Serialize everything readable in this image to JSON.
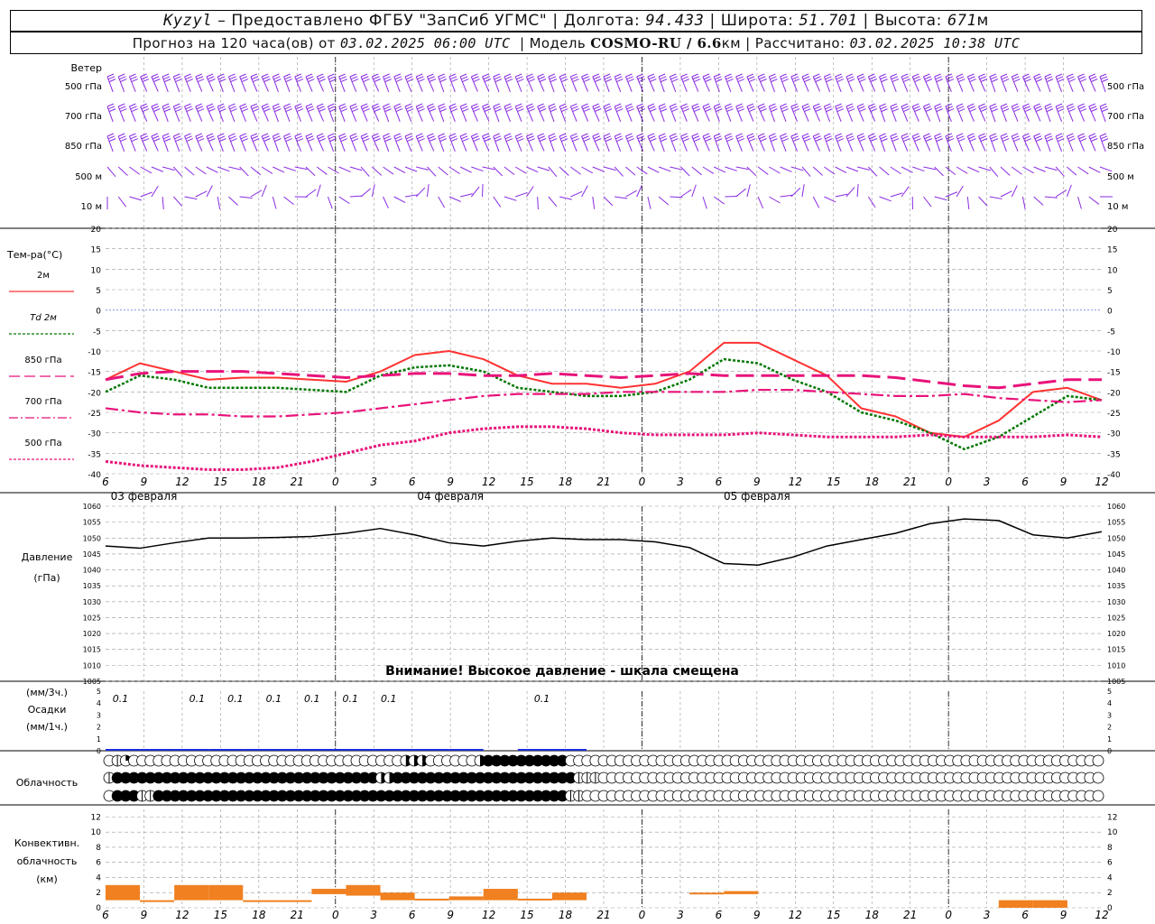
{
  "header": {
    "station": "Kyzyl",
    "provided_by": "– Предоставлено ФГБУ \"ЗапСиб УГМС\"",
    "lon_label": "Долгота:",
    "lon": "94.433",
    "lat_label": "Широта:",
    "lat": "51.701",
    "alt_label": "Высота:",
    "alt": "671",
    "alt_unit": "м",
    "forecast_label": "Прогноз на 120 часа(ов) от",
    "forecast_start": "03.02.2025 06:00 UTC",
    "model_label": "Модель",
    "model": "COSMO-RU / 6.6",
    "model_unit": "км",
    "computed_label": "Рассчитано:",
    "computed_at": "03.02.2025 10:38 UTC",
    "sep": "|"
  },
  "colors": {
    "t2m": "#ff3333",
    "td2m": "#007700",
    "t850": "#e8137a",
    "t700": "#e8137a",
    "t500": "#e8137a",
    "pressure": "#000000",
    "precip": "#1a2bdb",
    "convective": "#f08020",
    "wind": "#8a2be2",
    "zero_line": "#3a5ad8",
    "grid": "#999999"
  },
  "wind_panel": {
    "title": "Ветер",
    "levels": [
      "500 гПа",
      "700 гПа",
      "850 гПа",
      "500 м",
      "10  м"
    ]
  },
  "time_axis": {
    "hour_labels": [
      "6",
      "9",
      "12",
      "15",
      "18",
      "21",
      "0",
      "3",
      "6",
      "9",
      "12",
      "15",
      "18",
      "21",
      "0",
      "3",
      "6",
      "9",
      "12",
      "15",
      "18",
      "21",
      "0",
      "3",
      "6",
      "9",
      "12"
    ],
    "day_labels": [
      {
        "label": "03 февраля",
        "at_hour": 3
      },
      {
        "label": "04 февраля",
        "at_hour": 27
      },
      {
        "label": "05 февраля",
        "at_hour": 51
      }
    ],
    "day_starts_hours": [
      18,
      42,
      66,
      90
    ]
  },
  "temp_panel": {
    "title": "Тем-ра(°C)",
    "legend": [
      {
        "label": "2м",
        "key": "t2m"
      },
      {
        "label": "Td  2м",
        "key": "td2m"
      },
      {
        "label": "850 гПа",
        "key": "t850"
      },
      {
        "label": "700 гПа",
        "key": "t700"
      },
      {
        "label": "500 гПа",
        "key": "t500"
      }
    ],
    "y_ticks": [
      "20",
      "15",
      "10",
      "5",
      "0",
      "-5",
      "-10",
      "-15",
      "-20",
      "-25",
      "-30",
      "-35",
      "-40"
    ]
  },
  "pressure_panel": {
    "title": "Давление",
    "unit": "(гПа)",
    "y_ticks": [
      "1060",
      "1055",
      "1050",
      "1045",
      "1040",
      "1035",
      "1030",
      "1025",
      "1020",
      "1015",
      "1010",
      "1005"
    ],
    "warning": "Внимание! Высокое давление - шкала смещена"
  },
  "precip_panel": {
    "unit_top": "(мм/3ч.)",
    "title": "Осадки",
    "unit_bottom": "(мм/1ч.)",
    "y_ticks": [
      "5",
      "4",
      "3",
      "2",
      "1",
      "0"
    ],
    "labels": [
      {
        "text": "0.1",
        "hour": 0.6
      },
      {
        "text": "0.1",
        "hour": 6.6
      },
      {
        "text": "0.1",
        "hour": 9.6
      },
      {
        "text": "0.1",
        "hour": 12.6
      },
      {
        "text": "0.1",
        "hour": 15.6
      },
      {
        "text": "0.1",
        "hour": 18.6
      },
      {
        "text": "0.1",
        "hour": 21.6
      },
      {
        "text": "0.1",
        "hour": 33.6
      }
    ]
  },
  "cloud_panel": {
    "title": "Облачность",
    "rows": [
      "0120000000000000000000000000000000003330000003444444444400000000000000000000000000000000000000000000000000000000000000000",
      "1444444444444444444444444444444443344444444444444444444441110000000000000000000000000000000000000000000000000000000000000",
      "0444114444444444444444444444444444444444444444444444444411000000000000000000000000000000000000000000000000000000000000000"
    ]
  },
  "convective_panel": {
    "title_1": "Конвективн.",
    "title_2": "облачность",
    "unit": "(км)",
    "y_ticks": [
      "12",
      "10",
      "8",
      "6",
      "4",
      "2",
      "0"
    ]
  },
  "chart_data": [
    {
      "type": "line",
      "title": "Тем-ра(°C)",
      "x": [
        0,
        3,
        6,
        9,
        12,
        15,
        18,
        21,
        24,
        27,
        30,
        33,
        36,
        39,
        42,
        45,
        48,
        51,
        54,
        57,
        60,
        63,
        66,
        69,
        72,
        75,
        78
      ],
      "series": [
        {
          "name": "2м",
          "values": [
            -17,
            -13,
            -15,
            -17,
            -16.5,
            -16.5,
            -17,
            -17.5,
            -15,
            -11,
            -10,
            -12,
            -16,
            -18,
            -18,
            -19,
            -18,
            -15,
            -8,
            -8,
            -12,
            -16,
            -24,
            -26,
            -30,
            -31,
            -27,
            -20,
            -19,
            -22
          ]
        },
        {
          "name": "Td  2м",
          "values": [
            -20,
            -16,
            -17,
            -19,
            -19,
            -19,
            -19.5,
            -20,
            -16,
            -14,
            -13.5,
            -15,
            -19,
            -20,
            -21,
            -21,
            -20,
            -17,
            -12,
            -13,
            -17,
            -20,
            -25,
            -27,
            -30,
            -34,
            -31,
            -26,
            -21,
            -22
          ]
        },
        {
          "name": "850 гПа",
          "values": [
            -17,
            -15.5,
            -15,
            -15,
            -15,
            -15.5,
            -16,
            -16.5,
            -16,
            -15.5,
            -15.5,
            -16,
            -16,
            -15.5,
            -16,
            -16.5,
            -16,
            -15.5,
            -16,
            -16,
            -16,
            -16,
            -16,
            -16.5,
            -17.5,
            -18.5,
            -19,
            -18,
            -17,
            -17
          ]
        },
        {
          "name": "700 гПа",
          "values": [
            -24,
            -25,
            -25.5,
            -25.5,
            -26,
            -26,
            -25.5,
            -25,
            -24,
            -23,
            -22,
            -21,
            -20.5,
            -20.5,
            -20.5,
            -20,
            -20,
            -20,
            -20,
            -19.5,
            -19.5,
            -20,
            -20.5,
            -21,
            -21,
            -20.5,
            -21.5,
            -22,
            -22.5,
            -22
          ]
        },
        {
          "name": "500 гПа",
          "values": [
            -37,
            -38,
            -38.5,
            -39,
            -39,
            -38.5,
            -37,
            -35,
            -33,
            -32,
            -30,
            -29,
            -28.5,
            -28.5,
            -29,
            -30,
            -30.5,
            -30.5,
            -30.5,
            -30,
            -30.5,
            -31,
            -31,
            -31,
            -30.5,
            -31,
            -31,
            -31,
            -30.5,
            -31
          ]
        }
      ],
      "ylim": [
        -40,
        20
      ],
      "xlim": [
        0,
        78
      ]
    },
    {
      "type": "line",
      "title": "Давление",
      "x": [
        0,
        3,
        6,
        9,
        12,
        15,
        18,
        21,
        24,
        27,
        30,
        33,
        36,
        39,
        42,
        45,
        48,
        51,
        54,
        57,
        60,
        63,
        66,
        69,
        72,
        75,
        78
      ],
      "series": [
        {
          "name": "",
          "values": [
            1047.5,
            1046.8,
            1048.5,
            1050,
            1050,
            1050.2,
            1050.5,
            1051.5,
            1053,
            1051,
            1048.5,
            1047.5,
            1049,
            1050,
            1049.5,
            1049.5,
            1048.8,
            1047,
            1042,
            1041.5,
            1044,
            1047.5,
            1049.5,
            1051.5,
            1054.5,
            1056,
            1055.5,
            1051,
            1050,
            1052
          ]
        }
      ],
      "ylim": [
        1005,
        1060
      ],
      "xlim": [
        0,
        78
      ]
    },
    {
      "type": "bar",
      "title": "Осадки",
      "x": [
        0,
        3,
        6,
        9,
        12,
        15,
        18,
        21,
        24,
        27,
        30,
        33,
        36,
        39,
        42,
        45,
        48,
        51,
        54,
        57,
        60,
        63,
        66,
        69,
        72,
        75,
        78
      ],
      "values": [
        0.05,
        0.05,
        0.1,
        0.1,
        0.1,
        0.1,
        0.1,
        0.1,
        0.1,
        0.05,
        0.05,
        0,
        0.1,
        0.1,
        0,
        0,
        0,
        0,
        0,
        0,
        0,
        0,
        0,
        0,
        0,
        0,
        0,
        0,
        0,
        0
      ],
      "ylim": [
        0,
        5
      ]
    },
    {
      "type": "bar",
      "title": "Конвективн. облачность",
      "x": [
        0,
        3,
        6,
        9,
        12,
        15,
        18,
        21,
        24,
        27,
        30,
        33,
        36,
        39,
        42,
        45,
        48,
        51,
        54,
        57,
        60,
        63,
        66,
        69,
        72,
        75,
        78
      ],
      "bases": [
        1,
        1,
        1,
        1,
        1,
        1,
        1.8,
        1.6,
        1,
        1.2,
        1,
        1,
        1,
        1,
        0,
        0,
        0,
        1.8,
        1.8,
        0,
        0,
        0,
        0,
        0,
        0,
        0,
        0,
        0,
        0,
        0
      ],
      "tops": [
        3,
        1,
        3,
        3,
        1,
        1,
        2.5,
        3,
        2,
        1.2,
        1.5,
        2.5,
        1.2,
        2,
        0,
        0,
        0,
        2,
        2.2,
        0,
        0,
        0,
        0,
        0,
        0,
        0,
        1,
        1,
        0,
        0
      ],
      "ylim": [
        0,
        13
      ]
    }
  ]
}
